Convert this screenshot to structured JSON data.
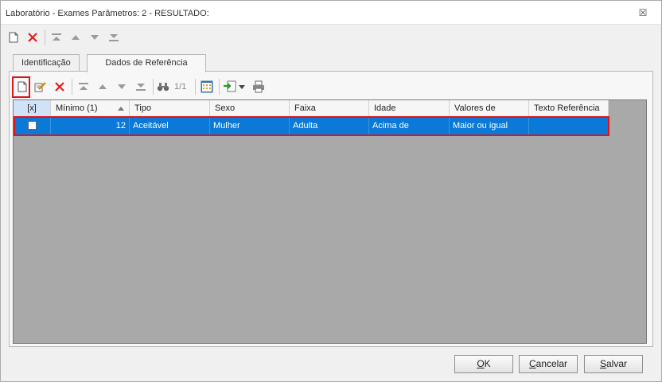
{
  "window": {
    "title": "Laboratório - Exames Parâmetros: 2 - RESULTADO:",
    "close_glyph": "☒"
  },
  "tabs": [
    {
      "label": "Identificação",
      "active": false
    },
    {
      "label": "Dados de Referência",
      "active": true
    }
  ],
  "inner_toolbar": {
    "pager_text": "1/1"
  },
  "grid": {
    "columns": [
      "[x]",
      "Mínimo (1)",
      "Tipo",
      "Sexo",
      "Faixa",
      "Idade",
      "Valores de",
      "Texto Referência"
    ],
    "rows": [
      {
        "checked": false,
        "minimo": "12",
        "tipo": "Aceitável",
        "sexo": "Mulher",
        "faixa": "Adulta",
        "idade": "Acima de",
        "valores_de": "Maior ou igual",
        "texto_referencia": ""
      }
    ]
  },
  "footer": {
    "ok_first": "O",
    "ok_rest": "K",
    "cancel_first": "C",
    "cancel_rest": "ancelar",
    "save_first": "S",
    "save_rest": "alvar"
  },
  "colors": {
    "selected_row": "#0a79d8",
    "highlight_border": "#e0121a",
    "grid_background": "#a9a9a9"
  }
}
